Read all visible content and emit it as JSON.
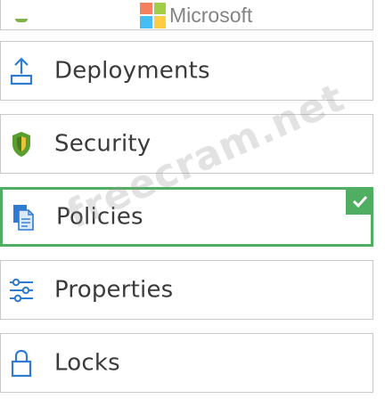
{
  "brand": {
    "name": "Microsoft",
    "logo_colors": [
      "#f25022",
      "#7fba00",
      "#00a4ef",
      "#ffb900"
    ]
  },
  "watermark": "freecram.net",
  "menu": {
    "items": [
      {
        "label": "Deployments",
        "icon": "upload-icon"
      },
      {
        "label": "Security",
        "icon": "shield-icon"
      },
      {
        "label": "Policies",
        "icon": "policy-document-icon",
        "selected": true
      },
      {
        "label": "Properties",
        "icon": "sliders-icon"
      },
      {
        "label": "Locks",
        "icon": "lock-icon"
      }
    ]
  },
  "colors": {
    "selected_border": "#4fae62",
    "icon_blue": "#2f7bd1",
    "shield_green": "#5a9e2f"
  }
}
